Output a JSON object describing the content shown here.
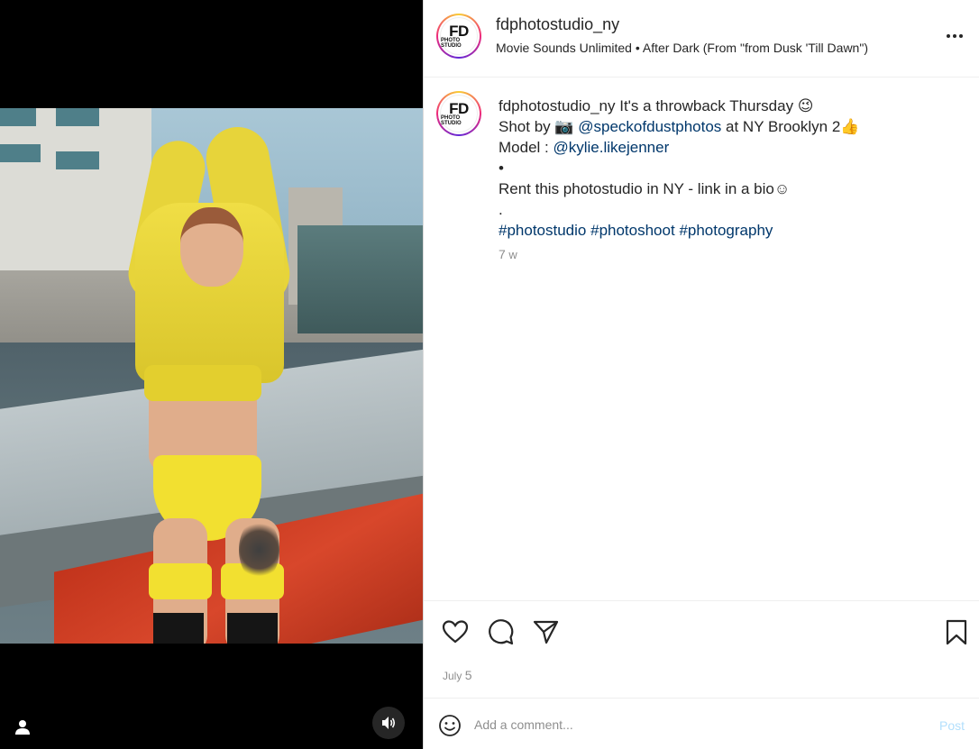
{
  "post": {
    "username": "fdphotostudio_ny",
    "avatar_text": "FD",
    "avatar_subtext": "PHOTO STUDIO",
    "audio": "Movie Sounds Unlimited • After Dark (From \"from Dusk 'Till Dawn\")"
  },
  "caption": {
    "username": "fdphotostudio_ny",
    "line1_text": " It's a throwback Thursday 😉",
    "line2_prefix": "Shot by 📷  ",
    "line2_mention": "@speckofdustphotos",
    "line2_suffix": " at NY Brooklyn 2👍",
    "line3_prefix": "Model : ",
    "line3_mention": "@kylie.likejenner",
    "line4": "•",
    "line5": "Rent this photostudio in NY - link in a bio☺",
    "line6": ".",
    "hashtag1": "#photostudio",
    "hashtag2": "#photoshoot",
    "hashtag3": "#photography",
    "time_num": "7",
    "time_unit": " w"
  },
  "actions": {
    "date_month": "July ",
    "date_day": "5"
  },
  "comment": {
    "placeholder": "Add a comment...",
    "post_label": "Post"
  },
  "icons": {
    "like": "heart-icon",
    "comment": "comment-icon",
    "share": "share-icon",
    "save": "bookmark-icon",
    "more": "more-icon",
    "emoji": "emoji-icon",
    "sound": "speaker-icon",
    "user_tag": "user-icon"
  },
  "colors": {
    "link": "#00376b",
    "muted": "#8e8e8e",
    "post_disabled": "#b2dffc"
  }
}
